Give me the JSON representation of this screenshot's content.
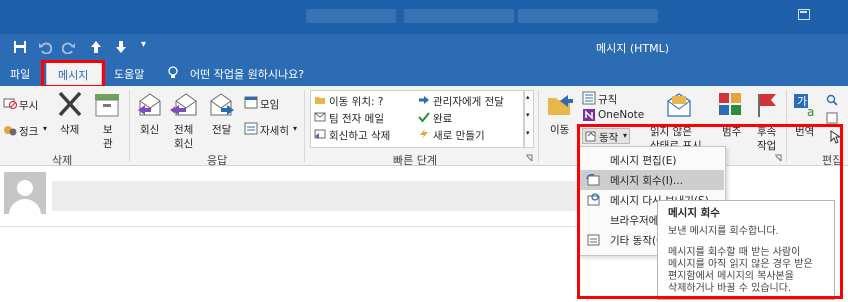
{
  "window": {
    "title": "메시지 (HTML)"
  },
  "quick_access": {
    "save_icon": "save-icon",
    "undo_icon": "undo-icon",
    "redo_icon": "redo-icon",
    "up_icon": "arrow-up-icon",
    "down_icon": "arrow-down-icon",
    "customize_icon": "customize-qat-icon"
  },
  "tabs": {
    "file": "파일",
    "message": "메시지",
    "help": "도움말",
    "tell_me": "어떤 작업을 원하시나요?"
  },
  "ribbon": {
    "delete_group": {
      "label": "삭제",
      "ignore": "무시",
      "junk": "정크",
      "delete": "삭제",
      "archive_line1": "보",
      "archive_line2": "관"
    },
    "respond_group": {
      "label": "응답",
      "reply": "회신",
      "reply_all_line1": "전체",
      "reply_all_line2": "회신",
      "forward": "전달",
      "meeting": "모임",
      "more": "자세히"
    },
    "quick_steps_group": {
      "label": "빠른 단계",
      "items": [
        "이동 위치: ?",
        "팀 전자 메일",
        "회신하고 삭제",
        "관리자에게 전달",
        "완료",
        "새로 만들기"
      ]
    },
    "move_group": {
      "move": "이동",
      "rules": "규칙",
      "onenote": "OneNote",
      "actions": "동작"
    },
    "tags_group": {
      "mark_unread_line1": "읽지 않은",
      "mark_unread_line2": "상태로 표시",
      "categorize_line1": "범주",
      "followup_line1": "후속",
      "followup_line2": "작업"
    },
    "editing_group": {
      "translate": "번역",
      "label": "편집"
    }
  },
  "actions_menu": {
    "items": [
      "메시지 편집(E)",
      "메시지 회수(I)...",
      "메시지 다시 보내기(S)...",
      "브라우저에서 보기(V)",
      "기타 동작(O)"
    ]
  },
  "tooltip": {
    "title": "메시지 회수",
    "line1": "보낸 메시지를 회수합니다.",
    "line2": "메시지를 회수할 때 받는 사람이",
    "line3": "메시지를 아직 읽지 않은 경우 받은",
    "line4": "편지함에서 메시지의 복사본을",
    "line5": "삭제하거나 바꿀 수 있습니다."
  },
  "colors": {
    "accent": "#2b6cb5",
    "highlight": "#ff0000"
  }
}
